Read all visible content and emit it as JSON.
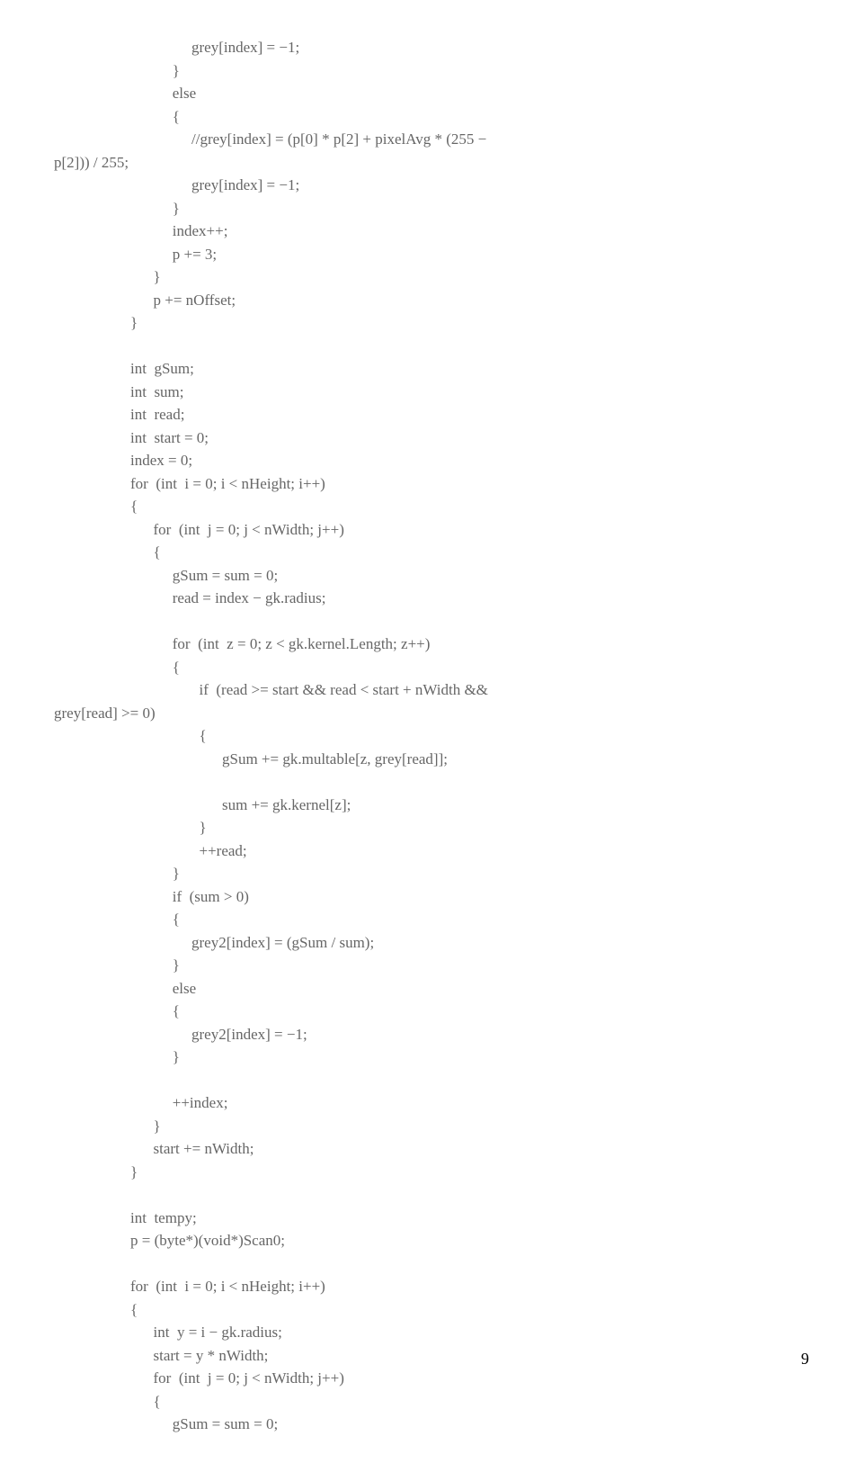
{
  "lines": [
    "                                    grey[index] = −1;",
    "                               }",
    "                               else",
    "                               {",
    "                                    //grey[index] = (p[0] * p[2] + pixelAvg * (255 −",
    "p[2])) / 255;",
    "                                    grey[index] = −1;",
    "                               }",
    "                               index++;",
    "                               p += 3;",
    "                          }",
    "                          p += nOffset;",
    "                    }",
    "",
    "                    int  gSum;",
    "                    int  sum;",
    "                    int  read;",
    "                    int  start = 0;",
    "                    index = 0;",
    "                    for  (int  i = 0; i < nHeight; i++)",
    "                    {",
    "                          for  (int  j = 0; j < nWidth; j++)",
    "                          {",
    "                               gSum = sum = 0;",
    "                               read = index − gk.radius;",
    "",
    "                               for  (int  z = 0; z < gk.kernel.Length; z++)",
    "                               {",
    "                                      if  (read >= start && read < start + nWidth &&",
    "grey[read] >= 0)",
    "                                      {",
    "                                            gSum += gk.multable[z, grey[read]];",
    "",
    "                                            sum += gk.kernel[z];",
    "                                      }",
    "                                      ++read;",
    "                               }",
    "                               if  (sum > 0)",
    "                               {",
    "                                    grey2[index] = (gSum / sum);",
    "                               }",
    "                               else",
    "                               {",
    "                                    grey2[index] = −1;",
    "                               }",
    "",
    "                               ++index;",
    "                          }",
    "                          start += nWidth;",
    "                    }",
    "",
    "                    int  tempy;",
    "                    p = (byte*)(void*)Scan0;",
    "",
    "                    for  (int  i = 0; i < nHeight; i++)",
    "                    {",
    "                          int  y = i − gk.radius;",
    "                          start = y * nWidth;",
    "                          for  (int  j = 0; j < nWidth; j++)",
    "                          {",
    "                               gSum = sum = 0;"
  ],
  "page_number": "9"
}
